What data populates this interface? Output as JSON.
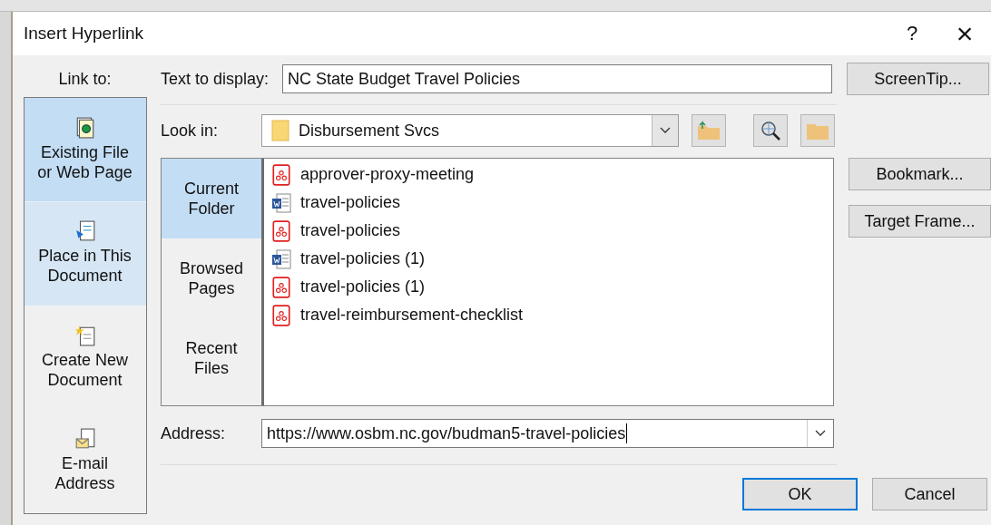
{
  "window": {
    "title": "Insert Hyperlink",
    "help": "?",
    "close": "×"
  },
  "link_to": {
    "label": "Link to:",
    "items": [
      {
        "label": "Existing File or Web Page",
        "kind": "file",
        "selected": true,
        "hovered": false
      },
      {
        "label": "Place in This Document",
        "kind": "place",
        "selected": false,
        "hovered": true
      },
      {
        "label": "Create New Document",
        "kind": "new",
        "selected": false,
        "hovered": false
      },
      {
        "label": "E-mail Address",
        "kind": "email",
        "selected": false,
        "hovered": false
      }
    ]
  },
  "text_to_display": {
    "label": "Text to display:",
    "value": "NC State Budget Travel Policies"
  },
  "screentip_button": "ScreenTip...",
  "look_in": {
    "label": "Look in:",
    "value": "Disbursement Svcs"
  },
  "browse_tabs": [
    {
      "label": "Current Folder",
      "selected": true
    },
    {
      "label": "Browsed Pages",
      "selected": false
    },
    {
      "label": "Recent Files",
      "selected": false
    }
  ],
  "files": [
    {
      "name": "approver-proxy-meeting",
      "kind": "pdf"
    },
    {
      "name": "travel-policies",
      "kind": "word"
    },
    {
      "name": "travel-policies",
      "kind": "pdf"
    },
    {
      "name": "travel-policies (1)",
      "kind": "word"
    },
    {
      "name": "travel-policies (1)",
      "kind": "pdf"
    },
    {
      "name": "travel-reimbursement-checklist",
      "kind": "pdf"
    }
  ],
  "side_buttons": [
    "Bookmark...",
    "Target Frame..."
  ],
  "address": {
    "label": "Address:",
    "value": "https://www.osbm.nc.gov/budman5-travel-policies"
  },
  "buttons": [
    {
      "label": "OK",
      "default": true
    },
    {
      "label": "Cancel",
      "default": false
    }
  ]
}
